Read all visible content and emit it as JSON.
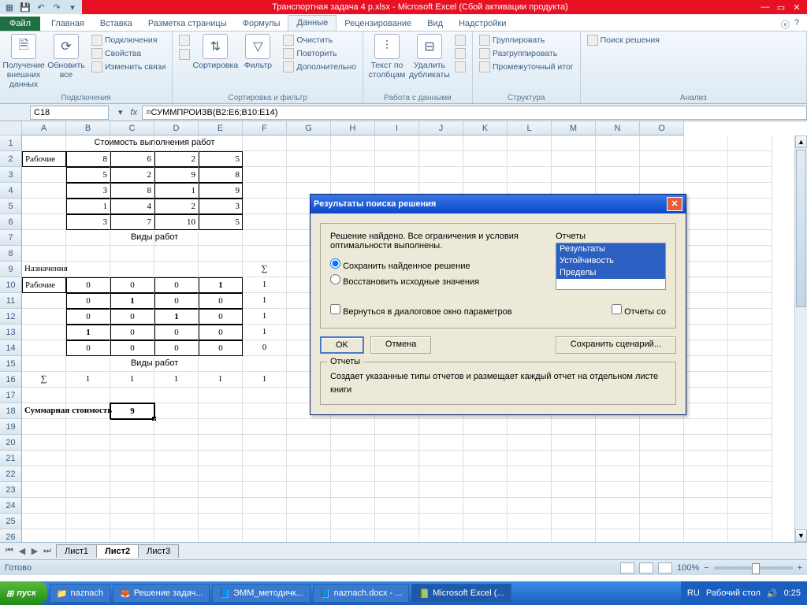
{
  "title_bar": {
    "title": "Транспортная задача 4 р.xlsx - Microsoft Excel (Сбой активации продукта)"
  },
  "ribbon": {
    "file": "Файл",
    "tabs": [
      "Главная",
      "Вставка",
      "Разметка страницы",
      "Формулы",
      "Данные",
      "Рецензирование",
      "Вид",
      "Надстройки"
    ],
    "active_tab": "Данные",
    "groups": {
      "connections": {
        "label": "Подключения",
        "get_ext": "Получение внешних данных",
        "refresh": "Обновить все",
        "conns": "Подключения",
        "props": "Свойства",
        "edit": "Изменить связи"
      },
      "sortfilter": {
        "label": "Сортировка и фильтр",
        "sort": "Сортировка",
        "filter": "Фильтр",
        "clear": "Очистить",
        "reapply": "Повторить",
        "advanced": "Дополнительно"
      },
      "datatools": {
        "label": "Работа с данными",
        "textcol": "Текст по столбцам",
        "dedup": "Удалить дубликаты"
      },
      "outline": {
        "label": "Структура",
        "group": "Группировать",
        "ungroup": "Разгруппировать",
        "subtotal": "Промежуточный итог"
      },
      "analysis": {
        "label": "Анализ",
        "solver": "Поиск решения"
      }
    }
  },
  "formula_bar": {
    "namebox": "C18",
    "formula": "=СУММПРОИЗВ(B2:E6;B10:E14)"
  },
  "columns": [
    "A",
    "B",
    "C",
    "D",
    "E",
    "F",
    "G",
    "H",
    "I",
    "J",
    "K",
    "L",
    "M",
    "N",
    "O"
  ],
  "cells": {
    "r1": {
      "span": "Стоимость выполнения работ"
    },
    "r2": {
      "A": "Рабочие",
      "B": "8",
      "C": "6",
      "D": "2",
      "E": "5"
    },
    "r3": {
      "B": "5",
      "C": "2",
      "D": "9",
      "E": "8"
    },
    "r4": {
      "B": "3",
      "C": "8",
      "D": "1",
      "E": "9"
    },
    "r5": {
      "B": "1",
      "C": "4",
      "D": "2",
      "E": "3"
    },
    "r6": {
      "B": "3",
      "C": "7",
      "D": "10",
      "E": "5"
    },
    "r7": {
      "span": "Виды работ"
    },
    "r9": {
      "A": "Назначения",
      "F": "∑"
    },
    "r10": {
      "A": "Рабочие",
      "B": "0",
      "C": "0",
      "D": "0",
      "E": "1",
      "F": "1"
    },
    "r11": {
      "B": "0",
      "C": "1",
      "D": "0",
      "E": "0",
      "F": "1"
    },
    "r12": {
      "B": "0",
      "C": "0",
      "D": "1",
      "E": "0",
      "F": "1"
    },
    "r13": {
      "B": "1",
      "C": "0",
      "D": "0",
      "E": "0",
      "F": "1"
    },
    "r14": {
      "B": "0",
      "C": "0",
      "D": "0",
      "E": "0",
      "F": "0"
    },
    "r15": {
      "span": "Виды работ"
    },
    "r16": {
      "A": "∑",
      "B": "1",
      "C": "1",
      "D": "1",
      "E": "1",
      "F": "1"
    },
    "r18": {
      "A": "Суммарная стоимость",
      "C": "9"
    }
  },
  "sheet_tabs": {
    "tabs": [
      "Лист1",
      "Лист2",
      "Лист3"
    ],
    "active": "Лист2"
  },
  "status": {
    "ready": "Готово",
    "zoom": "100%"
  },
  "dialog": {
    "title": "Результаты поиска решения",
    "msg": "Решение найдено. Все ограничения и условия оптимальности выполнены.",
    "opt_keep": "Сохранить найденное решение",
    "opt_restore": "Восстановить исходные значения",
    "reports_label": "Отчеты",
    "reports": [
      "Результаты",
      "Устойчивость",
      "Пределы"
    ],
    "chk_return": "Вернуться в диалоговое окно параметров",
    "chk_reports": "Отчеты со",
    "ok": "OK",
    "cancel": "Отмена",
    "save_scenario": "Сохранить сценарий...",
    "grp": "Отчеты",
    "grp_text": "Создает указанные типы отчетов и размещает каждый отчет на отдельном листе книги"
  },
  "taskbar": {
    "start": "пуск",
    "items": [
      "naznach",
      "Решение задач...",
      "ЭММ_методичк...",
      "naznach.docx - ...",
      "Microsoft Excel (..."
    ],
    "lang": "RU",
    "desktop": "Рабочий стол",
    "time": "0:25"
  }
}
